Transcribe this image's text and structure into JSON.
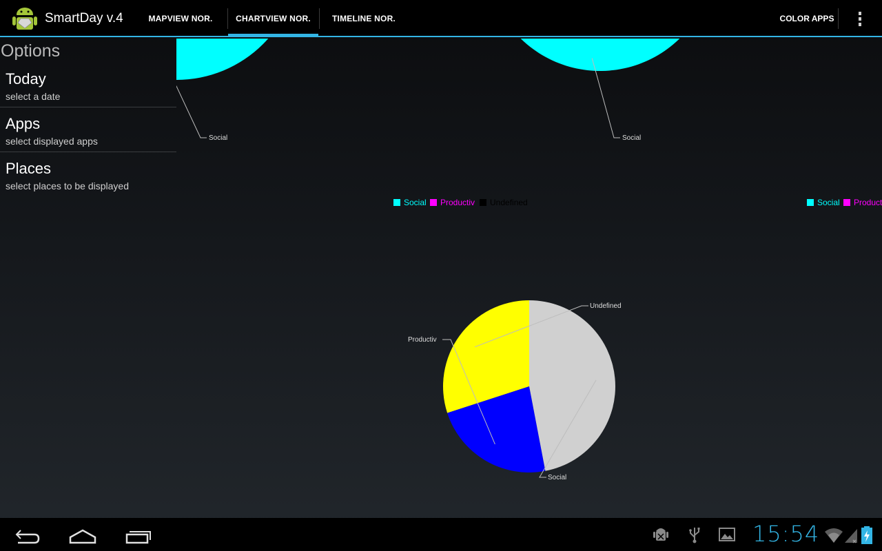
{
  "app": {
    "title": "SmartDay v.4",
    "icon": "android-robot-icon"
  },
  "tabs": [
    {
      "label": "MAPVIEW NOR.",
      "selected": false
    },
    {
      "label": "CHARTVIEW NOR.",
      "selected": true
    },
    {
      "label": "TIMELINE NOR.",
      "selected": false
    }
  ],
  "actions": {
    "color_apps": "COLOR APPS",
    "overflow_icon": "overflow-menu-icon"
  },
  "options": {
    "title": "Options",
    "items": [
      {
        "title": "Today",
        "subtitle": "select a date"
      },
      {
        "title": "Apps",
        "subtitle": "select displayed apps"
      },
      {
        "title": "Places",
        "subtitle": "select places to be displayed"
      }
    ]
  },
  "legend": {
    "left": [
      {
        "label": "Social",
        "color": "#00ffff"
      },
      {
        "label": "Productiv",
        "color": "#ff00ff"
      },
      {
        "label": "Undefined",
        "color": "#000000"
      }
    ],
    "right": [
      {
        "label": "Social",
        "color": "#00ffff"
      },
      {
        "label": "Product",
        "color": "#ff00ff"
      }
    ]
  },
  "chart_data": [
    {
      "type": "pie",
      "categories": [
        "Social"
      ],
      "values": [
        100
      ],
      "colors": [
        "#00ffff"
      ],
      "labels_visible": [
        "Social"
      ]
    },
    {
      "type": "pie",
      "categories": [
        "Social",
        "Productiv"
      ],
      "values": [
        99,
        1
      ],
      "colors": [
        "#00ffff",
        "#ff00ff"
      ],
      "labels_visible": [
        "Social"
      ]
    },
    {
      "type": "pie",
      "categories": [
        "Undefined",
        "Productiv",
        "Social"
      ],
      "values": [
        30,
        23,
        47
      ],
      "colors": [
        "#ffff00",
        "#0000ff",
        "#d0d0d0"
      ],
      "labels_visible": [
        "Undefined",
        "Productiv",
        "Social"
      ]
    }
  ],
  "system_bar": {
    "clock": "15:54",
    "nav_icons": [
      "back-icon",
      "home-icon",
      "recent-apps-icon"
    ],
    "status_icons": [
      "android-debug-icon",
      "usb-icon",
      "gallery-icon",
      "wifi-icon",
      "signal-icon",
      "battery-icon"
    ]
  }
}
